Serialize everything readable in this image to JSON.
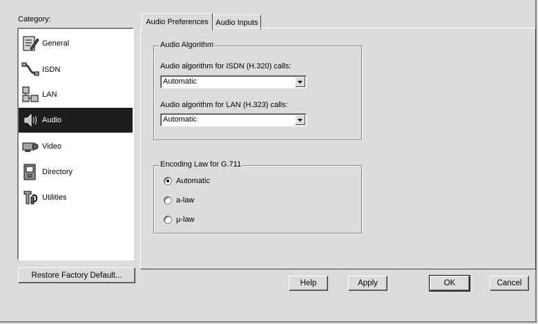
{
  "category": {
    "label": "Category:",
    "items": [
      {
        "label": "General",
        "icon": "general-icon",
        "selected": false
      },
      {
        "label": "ISDN",
        "icon": "isdn-icon",
        "selected": false
      },
      {
        "label": "LAN",
        "icon": "lan-icon",
        "selected": false
      },
      {
        "label": "Audio",
        "icon": "audio-icon",
        "selected": true
      },
      {
        "label": "Video",
        "icon": "video-icon",
        "selected": false
      },
      {
        "label": "Directory",
        "icon": "directory-icon",
        "selected": false
      },
      {
        "label": "Utilities",
        "icon": "utilities-icon",
        "selected": false
      }
    ]
  },
  "restore_button": "Restore Factory Default...",
  "tabs": [
    {
      "label": "Audio Preferences",
      "active": true
    },
    {
      "label": "Audio Inputs",
      "active": false
    }
  ],
  "audio_algorithm": {
    "title": "Audio Algorithm",
    "isdn_label": "Audio algorithm for ISDN (H.320) calls:",
    "isdn_value": "Automatic",
    "lan_label": "Audio algorithm for LAN (H.323) calls:",
    "lan_value": "Automatic"
  },
  "encoding": {
    "title": "Encoding Law for G.711",
    "options": [
      {
        "label": "Automatic",
        "checked": true
      },
      {
        "label": "a-law",
        "checked": false
      },
      {
        "label": "µ-law",
        "checked": false
      }
    ]
  },
  "buttons": {
    "help": "Help",
    "apply": "Apply",
    "ok": "OK",
    "cancel": "Cancel"
  },
  "colors": {
    "selection": "#1e1e1e",
    "background": "#dcdcdc"
  }
}
